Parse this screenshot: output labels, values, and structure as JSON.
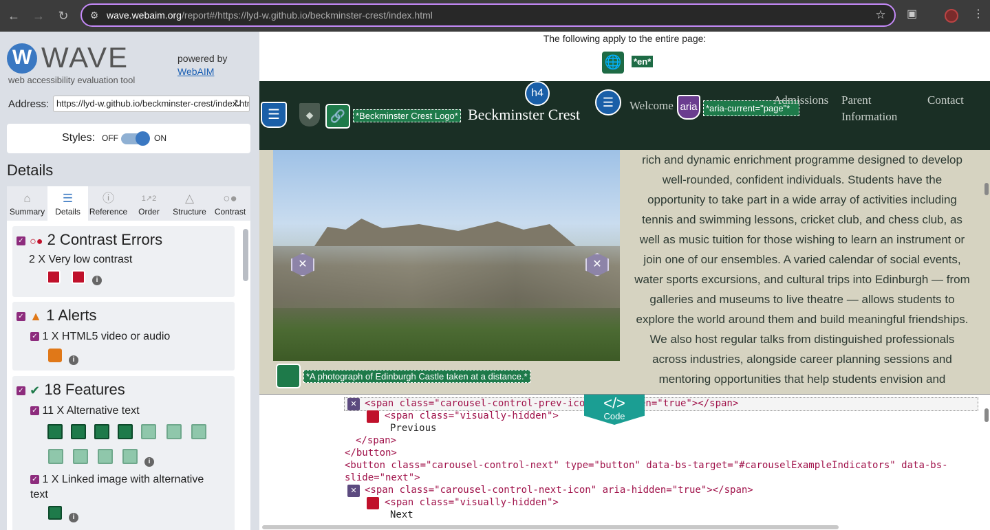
{
  "browser": {
    "url_host": "wave.webaim.org",
    "url_path": "/report#/https://lyd-w.github.io/beckminster-crest/index.html"
  },
  "wave": {
    "logo_letter": "W",
    "logo_text": "WAVE",
    "subtitle": "web accessibility evaluation tool",
    "powered_by": "powered by",
    "powered_link": "WebAIM",
    "address_label": "Address:",
    "address_value": "https://lyd-w.github.io/beckminster-crest/index.html",
    "styles_label": "Styles:",
    "styles_off": "OFF",
    "styles_on": "ON",
    "details_heading": "Details",
    "tabs": [
      {
        "label": "Summary",
        "icon": "home-icon"
      },
      {
        "label": "Details",
        "icon": "list-icon"
      },
      {
        "label": "Reference",
        "icon": "info-icon"
      },
      {
        "label": "Order",
        "icon": "order-icon"
      },
      {
        "label": "Structure",
        "icon": "structure-icon"
      },
      {
        "label": "Contrast",
        "icon": "contrast-icon"
      }
    ],
    "contrast": {
      "heading": "2 Contrast Errors",
      "item": "2 X Very low contrast"
    },
    "alerts": {
      "heading": "1 Alerts",
      "item": "1 X HTML5 video or audio"
    },
    "features": {
      "heading": "18 Features",
      "item1": "11 X Alternative text",
      "item2": "1 X Linked image with alternative text"
    }
  },
  "page": {
    "applies": "The following apply to the entire page:",
    "lang_tag": "*en*",
    "logo_alt": "*Beckminster Crest Logo*",
    "site_title": "Beckminster Crest",
    "h4": "h4",
    "nav_welcome": "Welcome",
    "aria_icon": "aria",
    "aria_current": "*aria-current=\"page\"*",
    "nav_admissions": "Admissions",
    "nav_parent": "Parent Information",
    "nav_contact": "Contact",
    "photo_alt": "*A photograph of Edinburgh Castle taken at a distance.*",
    "paragraph": "rich and dynamic enrichment programme designed to develop well-rounded, confident individuals. Students have the opportunity to take part in a wide array of activities including tennis and swimming lessons, cricket club, and chess club, as well as music tuition for those wishing to learn an instrument or join one of our ensembles. A varied calendar of social events, water sports excursions, and cultural trips into Edinburgh — from galleries and museums to live theatre — allows students to explore the world around them and build meaningful friendships. We also host regular talks from distinguished professionals across industries, alongside career planning sessions and mentoring opportunities that help students envision and"
  },
  "code": {
    "button_symbol": "</>",
    "button_label": "Code",
    "line1_a": "<span class=\"carousel-control-prev-icon",
    "line1_b": "en=\"true\"></span>",
    "line2": "<span class=\"visually-hidden\">",
    "line3": "Previous",
    "line4": "</span>",
    "line5": "</button>",
    "line6a": "<button class=\"carousel-control-next\" type=\"button\" data-bs-target=\"#carouselExampleIndicators\" data-bs-",
    "line6b": "slide=\"next\">",
    "line7": "<span class=\"carousel-control-next-icon\" aria-hidden=\"true\"></span>",
    "line8": "<span class=\"visually-hidden\">",
    "line9": "Next"
  }
}
